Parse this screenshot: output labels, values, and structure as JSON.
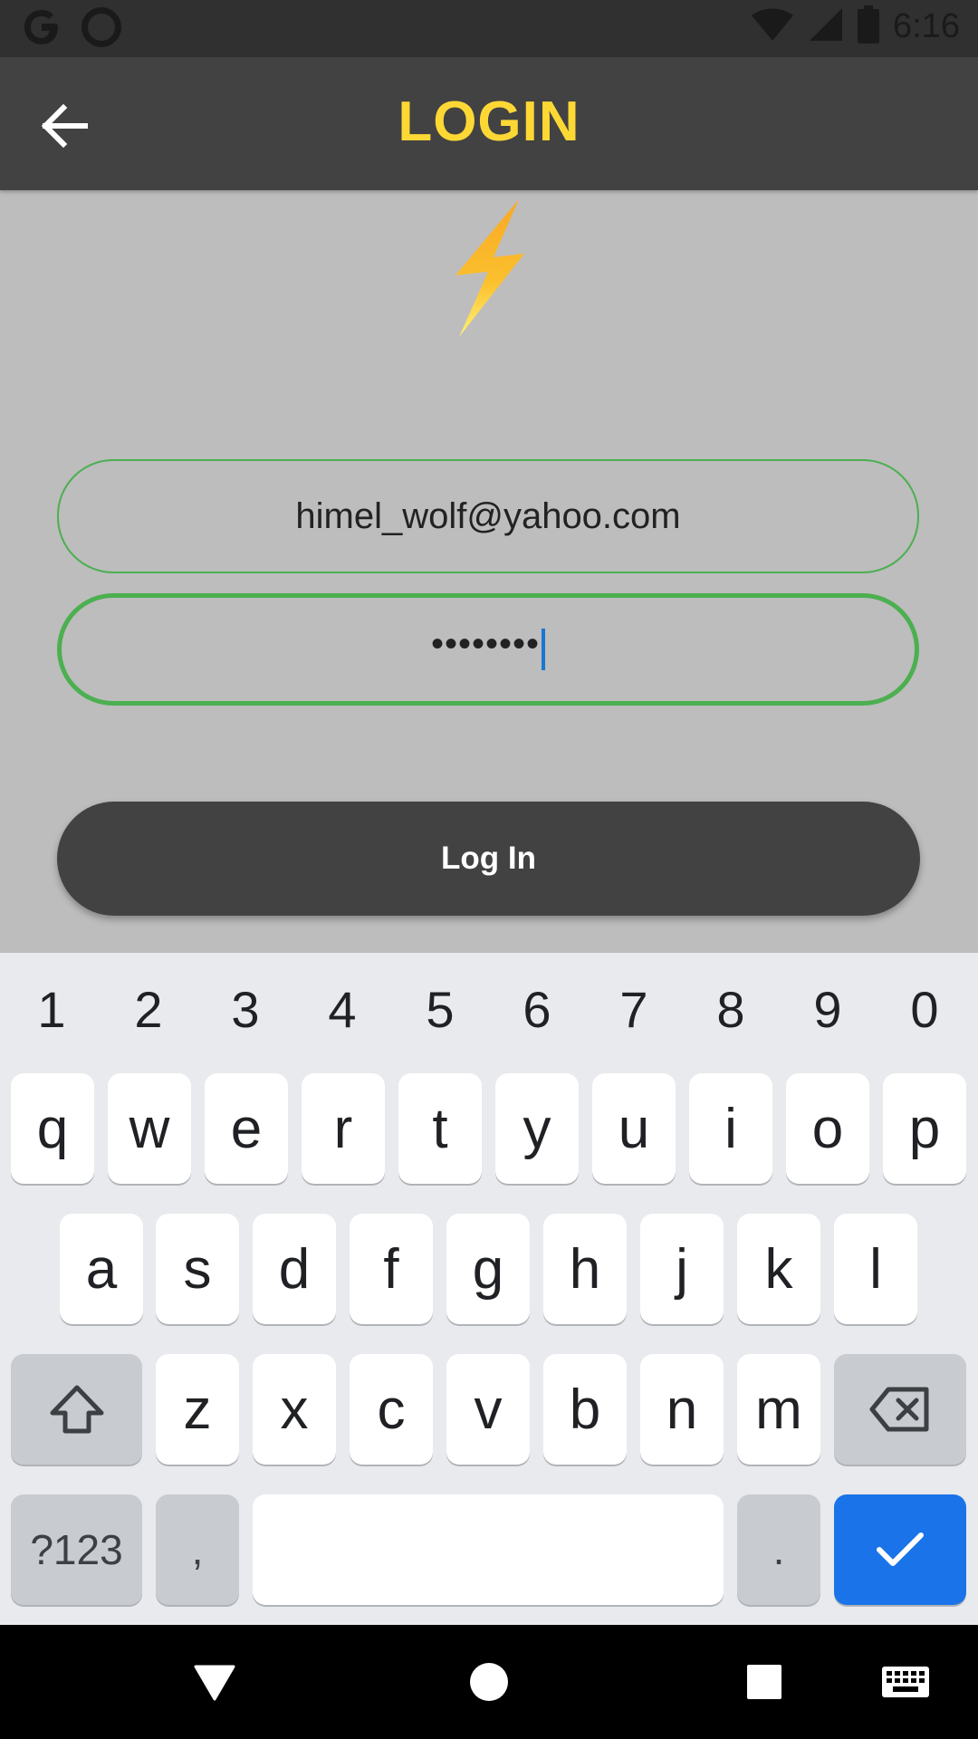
{
  "status_bar": {
    "time": "6:16",
    "icons": [
      "google-icon",
      "circle-notification-icon",
      "wifi-icon",
      "cellular-signal-icon",
      "battery-icon"
    ]
  },
  "app_bar": {
    "title": "LOGIN",
    "back_icon": "arrow-left-icon",
    "title_color": "#fdd835",
    "background": "#424242"
  },
  "logo": {
    "icon": "lightning-bolt-icon",
    "color": "#fbc02d"
  },
  "form": {
    "email_value": "himel_wolf@yahoo.com",
    "password_value": "••••••••",
    "field_border_color": "#4caf50",
    "login_label": "Log In"
  },
  "keyboard": {
    "number_row": [
      "1",
      "2",
      "3",
      "4",
      "5",
      "6",
      "7",
      "8",
      "9",
      "0"
    ],
    "row1": [
      "q",
      "w",
      "e",
      "r",
      "t",
      "y",
      "u",
      "i",
      "o",
      "p"
    ],
    "row2": [
      "a",
      "s",
      "d",
      "f",
      "g",
      "h",
      "j",
      "k",
      "l"
    ],
    "row3": [
      "z",
      "x",
      "c",
      "v",
      "b",
      "n",
      "m"
    ],
    "symbols_label": "?123",
    "comma_label": ",",
    "period_label": ".",
    "shift_icon": "shift-icon",
    "backspace_icon": "backspace-icon",
    "enter_icon": "checkmark-icon",
    "accent_color": "#1a73e8"
  },
  "nav_bar": {
    "icons": [
      "back-triangle-icon",
      "home-circle-icon",
      "recents-square-icon",
      "keyboard-switch-icon"
    ]
  }
}
